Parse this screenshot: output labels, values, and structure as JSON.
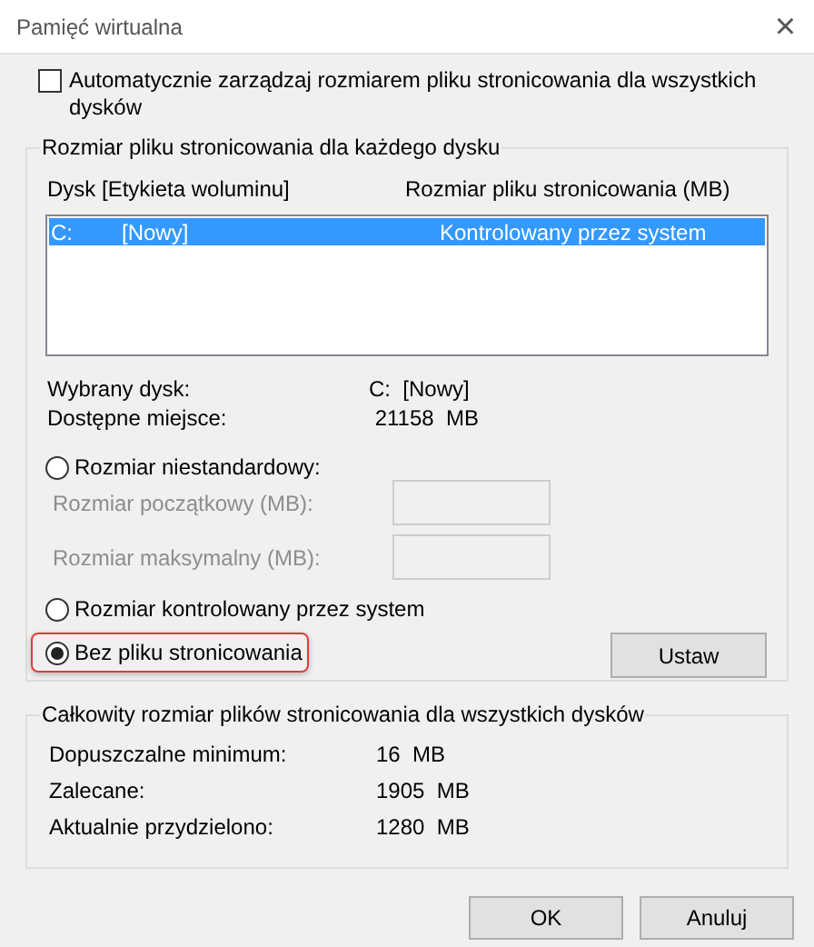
{
  "window": {
    "title": "Pamięć wirtualna",
    "close": "×"
  },
  "auto_manage": {
    "label": "Automatycznie zarządzaj rozmiarem pliku stronicowania dla wszystkich dysków",
    "checked": false
  },
  "per_drive": {
    "title": "Rozmiar pliku stronicowania dla każdego dysku",
    "columns": [
      "Dysk [Etykieta woluminu]",
      "Rozmiar pliku stronicowania (MB)"
    ],
    "rows": [
      {
        "drive": "C:",
        "label": "[Nowy]",
        "size": "Kontrolowany przez system",
        "selected": true
      }
    ],
    "info": [
      {
        "label": "Wybrany dysk:",
        "value": "C:  [Nowy]"
      },
      {
        "label": "Dostępne miejsce:",
        "value": " 21158  MB"
      }
    ],
    "options": [
      {
        "kind": "custom",
        "label": "Rozmiar niestandardowy:",
        "selected": false,
        "highlighted": false,
        "fields": [
          {
            "label": "Rozmiar początkowy (MB):",
            "disabled": true
          },
          {
            "label": "Rozmiar maksymalny (MB):",
            "disabled": true
          }
        ]
      },
      {
        "kind": "plain",
        "label": "Rozmiar kontrolowany przez system",
        "selected": false,
        "highlighted": false
      },
      {
        "kind": "plain",
        "label": "Bez pliku stronicowania",
        "selected": true,
        "highlighted": true
      }
    ],
    "set_button": "Ustaw"
  },
  "totals": {
    "title": "Całkowity rozmiar plików stronicowania dla wszystkich dysków",
    "rows": [
      {
        "label": "Dopuszczalne minimum:",
        "value": "16  MB"
      },
      {
        "label": "Zalecane:",
        "value": "1905  MB"
      },
      {
        "label": "Aktualnie przydzielono:",
        "value": "1280  MB"
      }
    ]
  },
  "buttons": [
    {
      "label": "OK"
    },
    {
      "label": "Anuluj"
    }
  ]
}
